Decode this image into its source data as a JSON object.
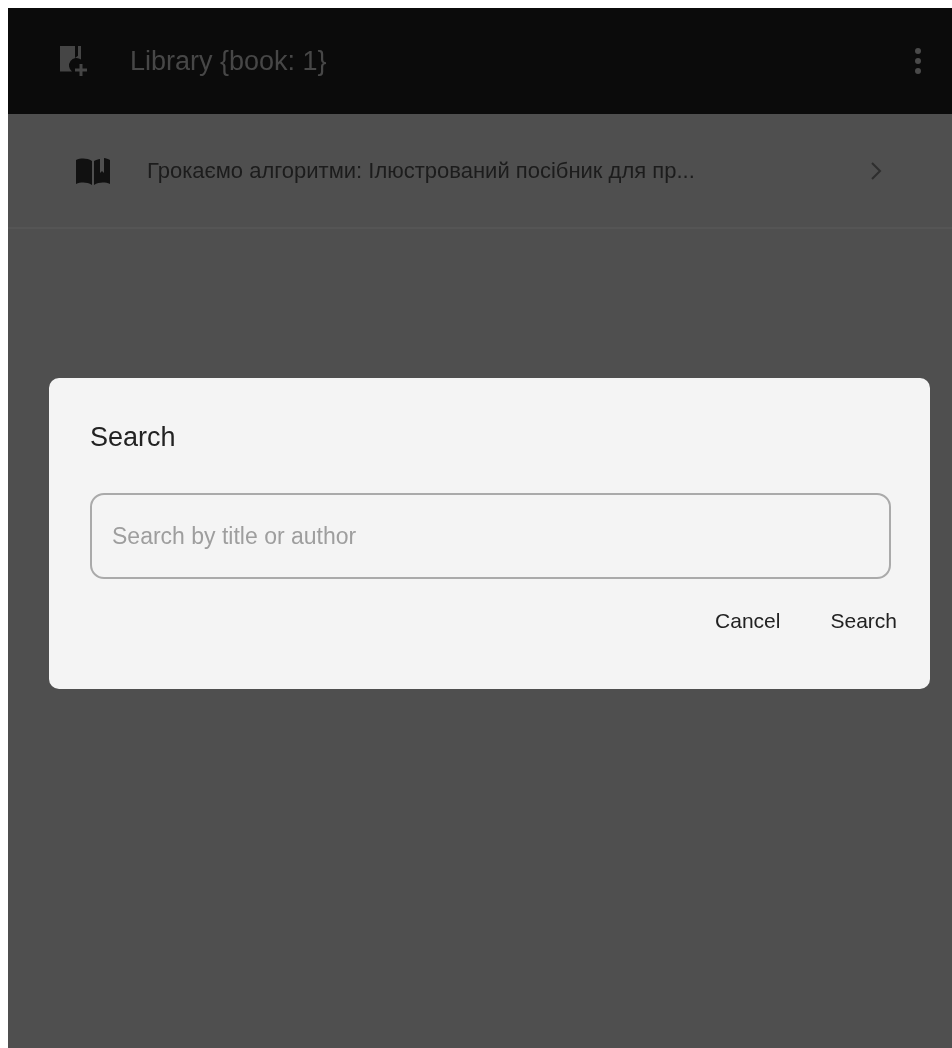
{
  "app_bar": {
    "title": "Library {book: 1}"
  },
  "books": [
    {
      "title": "Грокаємо алгоритми: Ілюстрований посібник для пр..."
    }
  ],
  "dialog": {
    "title": "Search",
    "search": {
      "placeholder": "Search by title or author"
    },
    "buttons": [
      "Cancel",
      "Search"
    ]
  }
}
